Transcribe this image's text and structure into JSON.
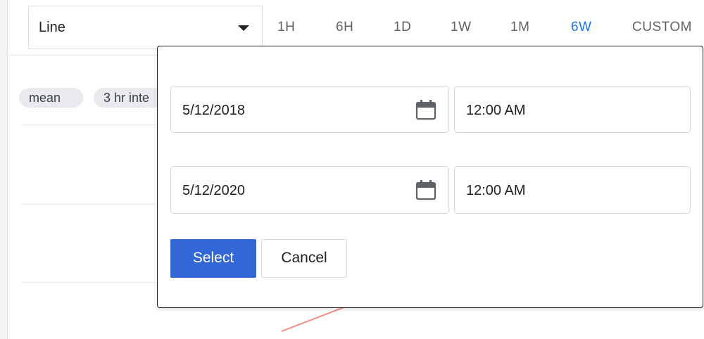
{
  "toolbar": {
    "chart_type": "Line",
    "ranges": [
      "1H",
      "6H",
      "1D",
      "1W",
      "1M",
      "6W",
      "CUSTOM"
    ],
    "active_range": "6W"
  },
  "chips": [
    "mean",
    "3 hr inte"
  ],
  "dialog": {
    "start_date": "5/12/2018",
    "start_time": "12:00 AM",
    "end_date": "5/12/2020",
    "end_time": "12:00 AM",
    "select_label": "Select",
    "cancel_label": "Cancel"
  },
  "colors": {
    "accent": "#1a73e8",
    "primary_button": "#3367d6",
    "chart_line": "#f28b82"
  }
}
